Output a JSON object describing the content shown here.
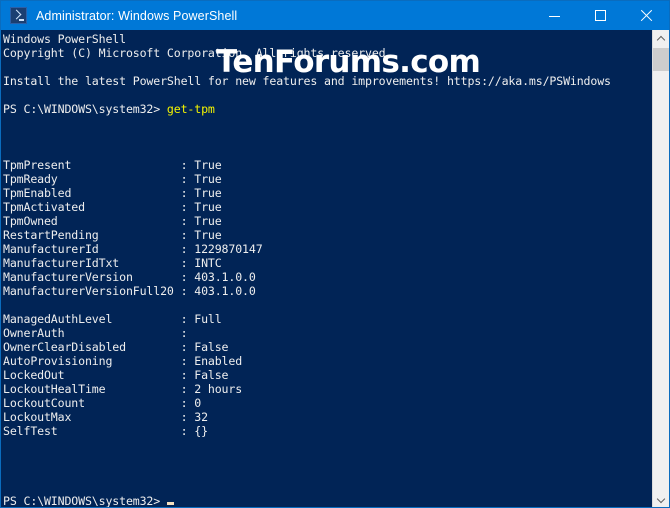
{
  "window": {
    "title": "Administrator: Windows PowerShell",
    "icon": "powershell-icon",
    "minimize_label": "─",
    "maximize_label": "☐",
    "close_label": "✕",
    "titlebar_color": "#0078d7",
    "console_bg_color": "#012456",
    "console_fg_color": "#eeeeee",
    "command_color": "#f3f300",
    "cursor_color": "#f5dfbe"
  },
  "watermark": {
    "text": "TenForums.com"
  },
  "console": {
    "lines": [
      {
        "text": "Windows PowerShell",
        "color": "white"
      },
      {
        "text": "Copyright (C) Microsoft Corporation. All rights reserved.",
        "color": "white"
      },
      {
        "text": "",
        "color": "white"
      },
      {
        "text": "Install the latest PowerShell for new features and improvements! https://aka.ms/PSWindows",
        "color": "white"
      },
      {
        "text": "",
        "color": "white"
      },
      {
        "prompt": "PS C:\\WINDOWS\\system32> ",
        "command": "get-tpm"
      },
      {
        "text": "",
        "color": "white"
      },
      {
        "text": "",
        "color": "white"
      },
      {
        "text": "",
        "color": "white"
      },
      {
        "text": "TpmPresent                : True",
        "color": "white"
      },
      {
        "text": "TpmReady                  : True",
        "color": "white"
      },
      {
        "text": "TpmEnabled                : True",
        "color": "white"
      },
      {
        "text": "TpmActivated              : True",
        "color": "white"
      },
      {
        "text": "TpmOwned                  : True",
        "color": "white"
      },
      {
        "text": "RestartPending            : True",
        "color": "white"
      },
      {
        "text": "ManufacturerId            : 1229870147",
        "color": "white"
      },
      {
        "text": "ManufacturerIdTxt         : INTC",
        "color": "white"
      },
      {
        "text": "ManufacturerVersion       : 403.1.0.0",
        "color": "white"
      },
      {
        "text": "ManufacturerVersionFull20 : 403.1.0.0",
        "color": "white"
      },
      {
        "text": "",
        "color": "white"
      },
      {
        "text": "ManagedAuthLevel          : Full",
        "color": "white"
      },
      {
        "text": "OwnerAuth                 :",
        "color": "white"
      },
      {
        "text": "OwnerClearDisabled        : False",
        "color": "white"
      },
      {
        "text": "AutoProvisioning          : Enabled",
        "color": "white"
      },
      {
        "text": "LockedOut                 : False",
        "color": "white"
      },
      {
        "text": "LockoutHealTime           : 2 hours",
        "color": "white"
      },
      {
        "text": "LockoutCount              : 0",
        "color": "white"
      },
      {
        "text": "LockoutMax                : 32",
        "color": "white"
      },
      {
        "text": "SelfTest                  : {}",
        "color": "white"
      },
      {
        "text": "",
        "color": "white"
      },
      {
        "text": "",
        "color": "white"
      },
      {
        "text": "",
        "color": "white"
      },
      {
        "text": "",
        "color": "white"
      },
      {
        "prompt": "PS C:\\WINDOWS\\system32> ",
        "command": "",
        "cursor": true
      }
    ],
    "tpm_properties": [
      {
        "name": "TpmPresent",
        "value": "True"
      },
      {
        "name": "TpmReady",
        "value": "True"
      },
      {
        "name": "TpmEnabled",
        "value": "True"
      },
      {
        "name": "TpmActivated",
        "value": "True"
      },
      {
        "name": "TpmOwned",
        "value": "True"
      },
      {
        "name": "RestartPending",
        "value": "True"
      },
      {
        "name": "ManufacturerId",
        "value": "1229870147"
      },
      {
        "name": "ManufacturerIdTxt",
        "value": "INTC"
      },
      {
        "name": "ManufacturerVersion",
        "value": "403.1.0.0"
      },
      {
        "name": "ManufacturerVersionFull20",
        "value": "403.1.0.0"
      },
      {
        "name": "ManagedAuthLevel",
        "value": "Full"
      },
      {
        "name": "OwnerAuth",
        "value": ""
      },
      {
        "name": "OwnerClearDisabled",
        "value": "False"
      },
      {
        "name": "AutoProvisioning",
        "value": "Enabled"
      },
      {
        "name": "LockedOut",
        "value": "False"
      },
      {
        "name": "LockoutHealTime",
        "value": "2 hours"
      },
      {
        "name": "LockoutCount",
        "value": "0"
      },
      {
        "name": "LockoutMax",
        "value": "32"
      },
      {
        "name": "SelfTest",
        "value": "{}"
      }
    ]
  },
  "scrollbar": {
    "up_arrow": "chevron-up",
    "down_arrow": "chevron-down"
  }
}
